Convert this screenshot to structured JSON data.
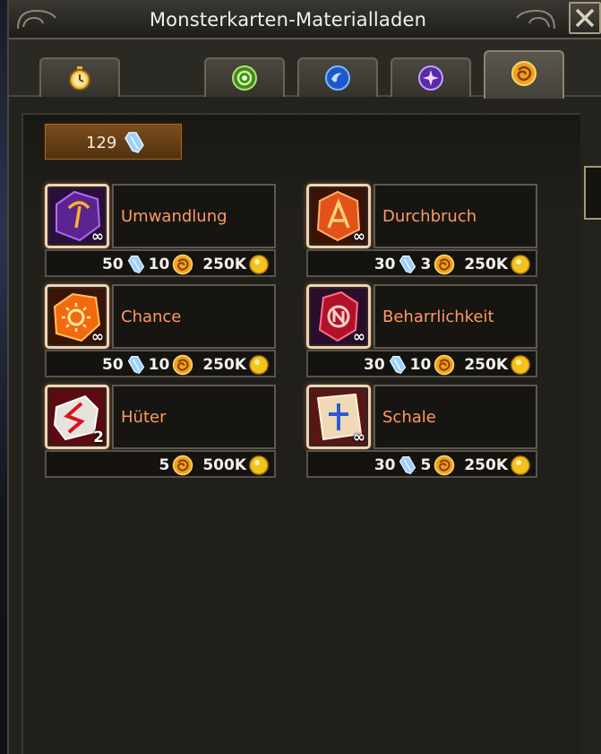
{
  "window": {
    "title": "Monsterkarten-Materialladen"
  },
  "tabs": [
    {
      "icon": "stopwatch-icon",
      "active": false
    },
    {
      "icon": "green-orb-icon",
      "active": false
    },
    {
      "icon": "blue-orb-icon",
      "active": false
    },
    {
      "icon": "purple-orb-icon",
      "active": false
    },
    {
      "icon": "gold-token-icon",
      "active": true
    }
  ],
  "currency": {
    "amount": "129",
    "icon": "crystal-icon"
  },
  "items": [
    {
      "name": "Umwandlung",
      "qty": "∞",
      "icon": "purple-rune-icon",
      "cost": {
        "crystal": "50",
        "token": "10",
        "gold": "250K"
      }
    },
    {
      "name": "Durchbruch",
      "qty": "∞",
      "icon": "orange-rune-icon",
      "cost": {
        "crystal": "30",
        "token": "3",
        "gold": "250K"
      }
    },
    {
      "name": "Chance",
      "qty": "∞",
      "icon": "sun-rune-icon",
      "cost": {
        "crystal": "50",
        "token": "10",
        "gold": "250K"
      }
    },
    {
      "name": "Beharrlichkeit",
      "qty": "∞",
      "icon": "red-rune-icon",
      "cost": {
        "crystal": "30",
        "token": "10",
        "gold": "250K"
      }
    },
    {
      "name": "Hüter",
      "qty": "2",
      "icon": "guardian-rune-icon",
      "cost": {
        "token": "5",
        "gold": "500K"
      }
    },
    {
      "name": "Schale",
      "qty": "∞",
      "icon": "cross-scroll-icon",
      "cost": {
        "crystal": "30",
        "token": "5",
        "gold": "250K"
      }
    }
  ],
  "colors": {
    "item_name": "#ff9a63",
    "frame": "#f1d3b2",
    "currency_bg": "#7c4d1d"
  }
}
